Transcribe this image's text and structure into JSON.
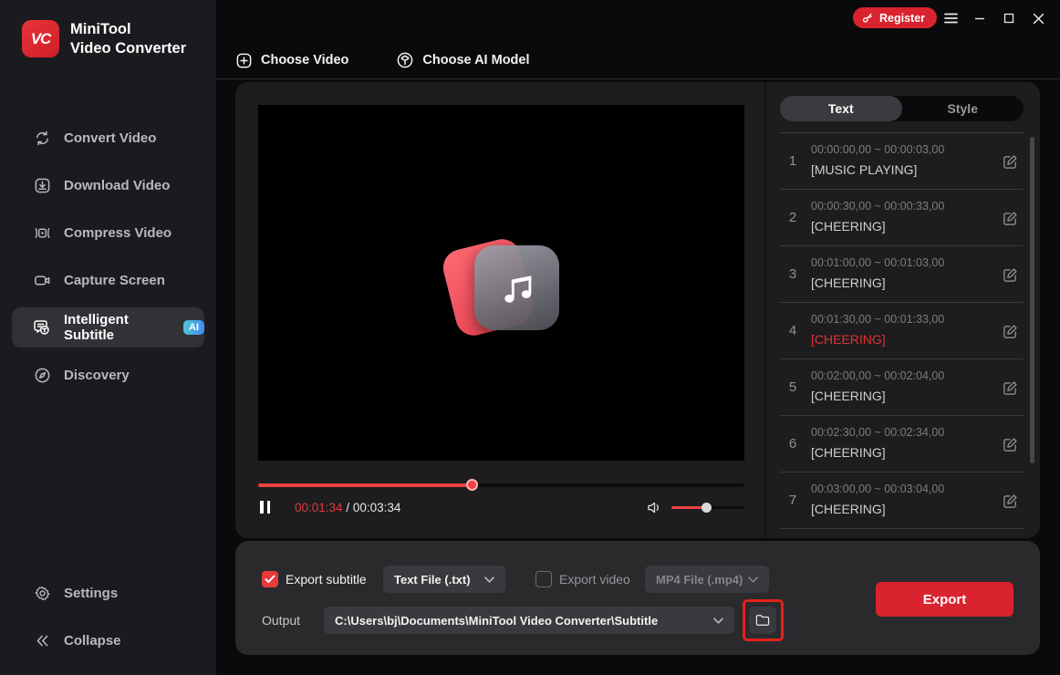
{
  "titlebar": {
    "register_label": "Register"
  },
  "sidebar": {
    "brand": {
      "logo_text": "VC",
      "title_line1": "MiniTool",
      "title_line2": "Video Converter"
    },
    "items": [
      {
        "label": "Convert Video"
      },
      {
        "label": "Download Video"
      },
      {
        "label": "Compress Video"
      },
      {
        "label": "Capture Screen"
      },
      {
        "label": "Intelligent Subtitle",
        "badge": "AI",
        "active": true
      },
      {
        "label": "Discovery"
      }
    ],
    "settings_label": "Settings",
    "collapse_label": "Collapse"
  },
  "toolbar": {
    "choose_video_label": "Choose Video",
    "choose_ai_model_label": "Choose AI Model"
  },
  "player": {
    "current_time": "00:01:34",
    "separator": "/",
    "total_time": "00:03:34",
    "progress_percent": 44,
    "volume_percent": 49
  },
  "subtitles": {
    "tabs": [
      {
        "label": "Text",
        "active": true
      },
      {
        "label": "Style",
        "active": false
      }
    ],
    "rows": [
      {
        "num": "1",
        "time": "00:00:00,00 ~ 00:00:03,00",
        "text": "[MUSIC PLAYING]",
        "active": false
      },
      {
        "num": "2",
        "time": "00:00:30,00 ~ 00:00:33,00",
        "text": "[CHEERING]",
        "active": false
      },
      {
        "num": "3",
        "time": "00:01:00,00 ~ 00:01:03,00",
        "text": "[CHEERING]",
        "active": false
      },
      {
        "num": "4",
        "time": "00:01:30,00 ~ 00:01:33,00",
        "text": "[CHEERING]",
        "active": true
      },
      {
        "num": "5",
        "time": "00:02:00,00 ~ 00:02:04,00",
        "text": "[CHEERING]",
        "active": false
      },
      {
        "num": "6",
        "time": "00:02:30,00 ~ 00:02:34,00",
        "text": "[CHEERING]",
        "active": false
      },
      {
        "num": "7",
        "time": "00:03:00,00 ~ 00:03:04,00",
        "text": "[CHEERING]",
        "active": false
      }
    ]
  },
  "export_bar": {
    "export_subtitle": {
      "label": "Export subtitle",
      "checked": true,
      "format_value": "Text File (.txt)"
    },
    "export_video": {
      "label": "Export video",
      "checked": false,
      "format_value": "MP4 File (.mp4)"
    },
    "output": {
      "label": "Output",
      "path_value": "C:\\Users\\bj\\Documents\\MiniTool Video Converter\\Subtitle"
    },
    "export_button_label": "Export"
  },
  "colors": {
    "accent_red": "#d9232e",
    "progress_red": "#ef4043",
    "active_subtitle_red": "#e03030",
    "ai_badge_gradient": [
      "#4fc7d6",
      "#3f8df2"
    ],
    "annotation_red": "#e3211a"
  }
}
